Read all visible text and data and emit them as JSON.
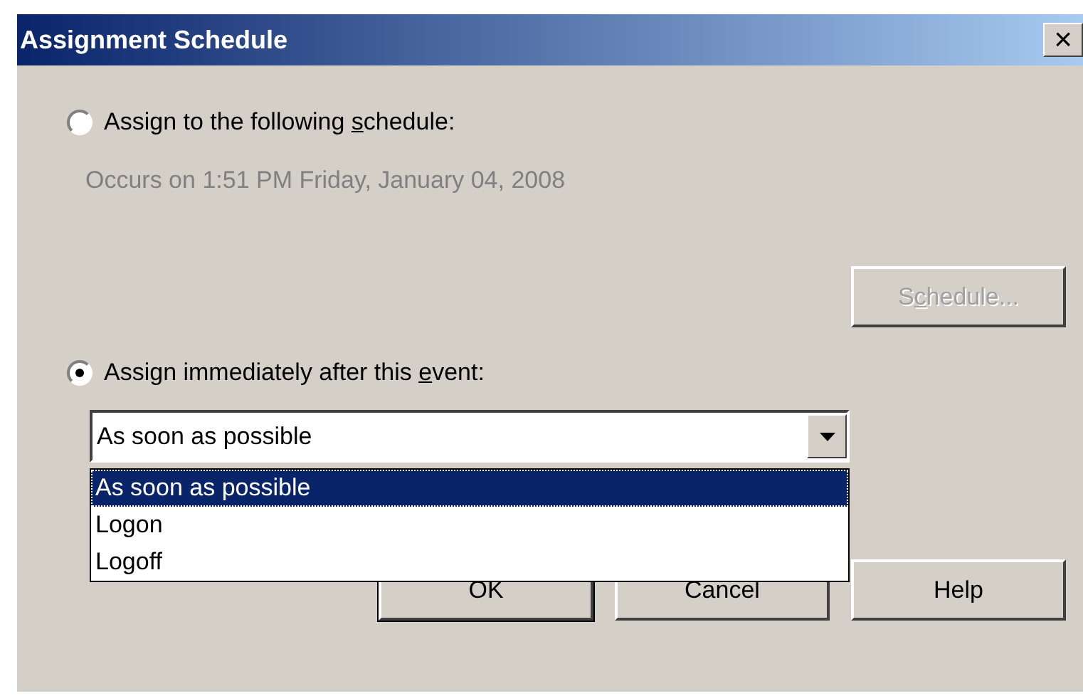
{
  "window": {
    "title": "Assignment Schedule",
    "close": "×"
  },
  "options": [
    {
      "label": {
        "before": "Assign to the following ",
        "key": "s",
        "after": "chedule:"
      },
      "selected": false
    },
    {
      "label": {
        "before": "Assign immediately after this ",
        "key": "e",
        "after": "vent:"
      },
      "selected": true
    }
  ],
  "schedule_text": "Occurs on 1:51 PM Friday, January 04, 2008",
  "schedule_button": {
    "label": {
      "before": "S",
      "key": "c",
      "after": "hedule..."
    },
    "disabled": true
  },
  "combo": {
    "value": "As soon as possible",
    "expanded": true,
    "items": [
      {
        "label": "As soon as possible",
        "selected": true
      },
      {
        "label": "Logon",
        "selected": false
      },
      {
        "label": "Logoff",
        "selected": false
      }
    ]
  },
  "buttons": [
    {
      "label": "OK",
      "default": true
    },
    {
      "label": "Cancel",
      "default": false
    },
    {
      "label": "Help",
      "default": false
    }
  ]
}
